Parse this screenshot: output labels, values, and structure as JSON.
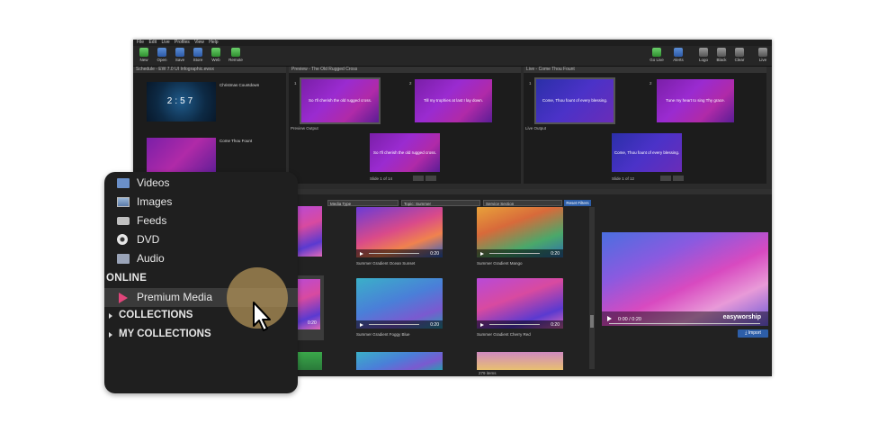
{
  "menu": [
    "File",
    "Edit",
    "Live",
    "Profiles",
    "View",
    "Help"
  ],
  "toolbar": {
    "left": [
      "New",
      "Open",
      "Save",
      "Store",
      "Web",
      "Remote"
    ],
    "right": [
      "Go Live",
      "Alerts",
      "Logo",
      "Black",
      "Clear",
      "Live"
    ]
  },
  "schedule": {
    "title": "Schedule - EW 7.0 UI Infographic.ewsx",
    "items": [
      {
        "name": "Christmas Countdown",
        "sub": "",
        "countdown": "2:57"
      },
      {
        "name": "Come Thou Fount",
        "sub": ""
      }
    ]
  },
  "preview": {
    "title": "Preview - The Old Rugged Cross",
    "slides": [
      {
        "num": "1",
        "text": "So I'll cherish the old rugged cross."
      },
      {
        "num": "2",
        "text": "Till my trophies at last I lay down."
      }
    ],
    "output_label": "Preview Output",
    "output_text": "So I'll cherish the old rugged cross.",
    "slide_counter": "Slide 1 of 14"
  },
  "live": {
    "title": "Live - Come Thou Fount",
    "slides": [
      {
        "num": "1",
        "text": "Come, Thou fount of every blessing."
      },
      {
        "num": "2",
        "text": "Tune my heart to sing Thy grace."
      }
    ],
    "output_label": "Live Output",
    "output_text": "Come, Thou fount of every blessing.",
    "slide_counter": "Slide 1 of 12"
  },
  "filters": {
    "media_type": "Media Type",
    "topic": "Topic: Summer",
    "service_section": "Service Section",
    "reset": "Reset Filters"
  },
  "media": [
    {
      "name": "Summer Gradient Ocean Sunset",
      "duration": "0:20"
    },
    {
      "name": "Summer Gradient Mango",
      "duration": "0:20"
    },
    {
      "name": "Summer Gradient Foggy Blue",
      "duration": "0:20"
    },
    {
      "name": "Summer Gradient Cherry Red",
      "duration": "0:20"
    }
  ],
  "left_thumb_duration": "0:20",
  "items_count": "279 items",
  "player": {
    "time": "0:00 / 0:20",
    "watermark": "easyworship",
    "import_label": "Import"
  },
  "callout": {
    "items": [
      {
        "label": "Videos",
        "icon": "film-icon"
      },
      {
        "label": "Images",
        "icon": "image-icon"
      },
      {
        "label": "Feeds",
        "icon": "camera-icon"
      },
      {
        "label": "DVD",
        "icon": "disc-icon"
      },
      {
        "label": "Audio",
        "icon": "speaker-icon"
      }
    ],
    "online_heading": "ONLINE",
    "premium": "Premium Media",
    "collections": "COLLECTIONS",
    "my_collections": "MY COLLECTIONS"
  },
  "colors": {
    "accent": "#2d5ea8",
    "highlight": "#b8975a",
    "panel": "#1f1f1f"
  }
}
